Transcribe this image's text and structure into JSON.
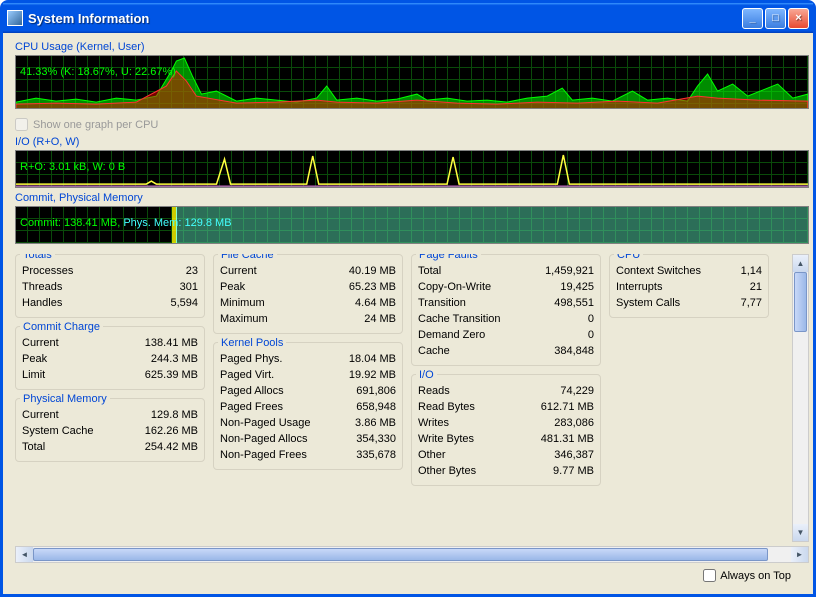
{
  "window": {
    "title": "System Information"
  },
  "graphs": {
    "cpu": {
      "title": "CPU Usage (Kernel, User)",
      "readout": "41.33% (K: 18.67%, U: 22.67%)"
    },
    "show_per_cpu": "Show one graph per CPU",
    "io": {
      "title": "I/O (R+O, W)",
      "readout": "R+O: 3.01 kB, W: 0 B"
    },
    "mem": {
      "title": "Commit, Physical Memory",
      "commit": "Commit: 138.41 MB, ",
      "phys_label": "Phys. Mem: ",
      "phys_val": "129.8 MB"
    }
  },
  "totals": {
    "title": "Totals",
    "processes_l": "Processes",
    "processes_v": "23",
    "threads_l": "Threads",
    "threads_v": "301",
    "handles_l": "Handles",
    "handles_v": "5,594"
  },
  "commit": {
    "title": "Commit Charge",
    "current_l": "Current",
    "current_v": "138.41 MB",
    "peak_l": "Peak",
    "peak_v": "244.3 MB",
    "limit_l": "Limit",
    "limit_v": "625.39 MB"
  },
  "physmem": {
    "title": "Physical Memory",
    "current_l": "Current",
    "current_v": "129.8 MB",
    "syscache_l": "System Cache",
    "syscache_v": "162.26 MB",
    "total_l": "Total",
    "total_v": "254.42 MB"
  },
  "filecache": {
    "title": "File Cache",
    "current_l": "Current",
    "current_v": "40.19 MB",
    "peak_l": "Peak",
    "peak_v": "65.23 MB",
    "min_l": "Minimum",
    "min_v": "4.64 MB",
    "max_l": "Maximum",
    "max_v": "24 MB"
  },
  "kernel": {
    "title": "Kernel Pools",
    "pphys_l": "Paged Phys.",
    "pphys_v": "18.04 MB",
    "pvirt_l": "Paged Virt.",
    "pvirt_v": "19.92 MB",
    "pallocs_l": "Paged Allocs",
    "pallocs_v": "691,806",
    "pfrees_l": "Paged Frees",
    "pfrees_v": "658,948",
    "npu_l": "Non-Paged Usage",
    "npu_v": "3.86 MB",
    "npa_l": "Non-Paged Allocs",
    "npa_v": "354,330",
    "npf_l": "Non-Paged Frees",
    "npf_v": "335,678"
  },
  "faults": {
    "title": "Page Faults",
    "total_l": "Total",
    "total_v": "1,459,921",
    "cow_l": "Copy-On-Write",
    "cow_v": "19,425",
    "trans_l": "Transition",
    "trans_v": "498,551",
    "ctrans_l": "Cache Transition",
    "ctrans_v": "0",
    "dz_l": "Demand Zero",
    "dz_v": "0",
    "cache_l": "Cache",
    "cache_v": "384,848"
  },
  "ioblock": {
    "title": "I/O",
    "reads_l": "Reads",
    "reads_v": "74,229",
    "rbytes_l": "Read Bytes",
    "rbytes_v": "612.71 MB",
    "writes_l": "Writes",
    "writes_v": "283,086",
    "wbytes_l": "Write Bytes",
    "wbytes_v": "481.31 MB",
    "other_l": "Other",
    "other_v": "346,387",
    "obytes_l": "Other Bytes",
    "obytes_v": "9.77 MB"
  },
  "cpublock": {
    "title": "CPU",
    "cs_l": "Context Switches",
    "cs_v": "1,14",
    "int_l": "Interrupts",
    "int_v": "21",
    "sc_l": "System Calls",
    "sc_v": "7,77"
  },
  "footer": {
    "always_on_top": "Always on Top"
  }
}
